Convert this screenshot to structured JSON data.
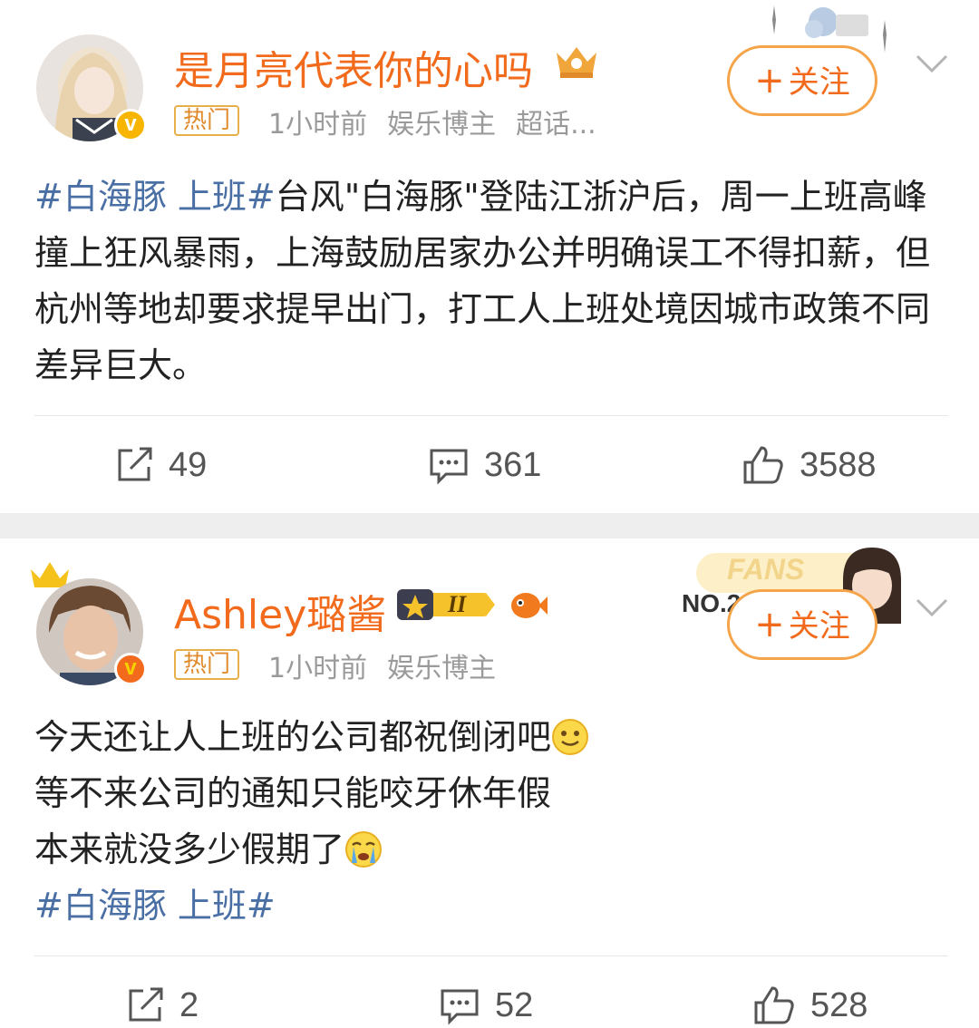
{
  "posts": [
    {
      "username": "是月亮代表你的心吗",
      "hot_badge": "热门",
      "time": "1小时前",
      "role": "娱乐博主",
      "topic": "超话...",
      "follow_label": "关注",
      "hashtag": "#白海豚 上班#",
      "text": "台风\"白海豚\"登陆江浙沪后，周一上班高峰撞上狂风暴雨，上海鼓励居家办公并明确误工不得扣薪，但杭州等地却要求提早出门，打工人上班处境因城市政策不同差异巨大。",
      "reposts": "49",
      "comments": "361",
      "likes": "3588"
    },
    {
      "username": "Ashley璐酱",
      "hot_badge": "热门",
      "time": "1小时前",
      "role": "娱乐博主",
      "follow_label": "关注",
      "fans_label": "FANS",
      "fans_rank": "NO.2",
      "level_badge": "II",
      "line1": "今天还让人上班的公司都祝倒闭吧",
      "line2": "等不来公司的通知只能咬牙休年假",
      "line3": "本来就没多少假期了",
      "hashtag": "#白海豚 上班#",
      "reposts": "2",
      "comments": "52",
      "likes": "528"
    }
  ],
  "colors": {
    "username": "#f26b1d",
    "hashtag": "#4a6fa5",
    "meta": "#9a9a9a",
    "follow_border": "#f5a44a",
    "separator": "#eeeeee"
  },
  "icons": [
    "chevron-down-icon",
    "repost-icon",
    "comment-icon",
    "like-icon",
    "verified-icon",
    "smile-emoji",
    "crying-emoji",
    "crown-icon"
  ]
}
